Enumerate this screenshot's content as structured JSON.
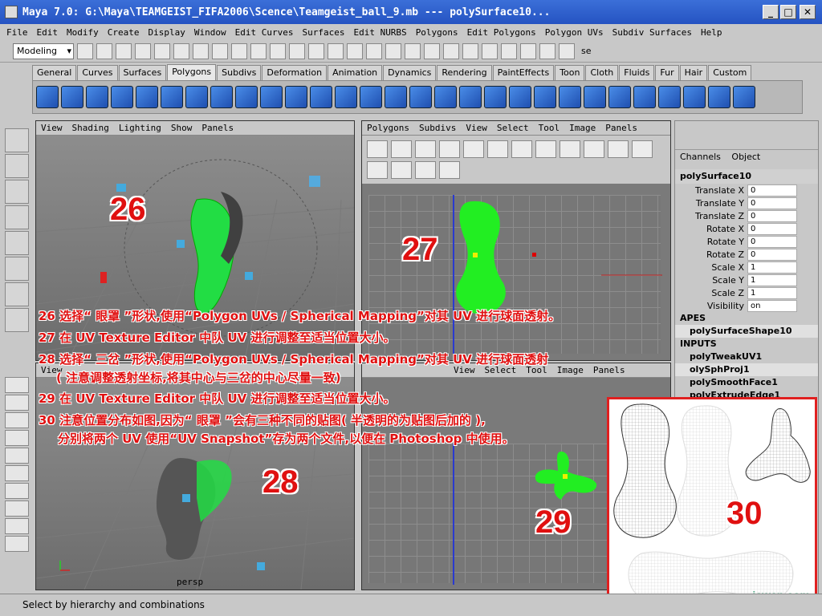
{
  "window": {
    "title": "Maya 7.0: G:\\Maya\\TEAMGEIST_FIFA2006\\Scence\\Teamgeist_ball_9.mb   ---   polySurface10...",
    "minimize": "_",
    "maximize": "□",
    "close": "✕"
  },
  "menubar": [
    "File",
    "Edit",
    "Modify",
    "Create",
    "Display",
    "Window",
    "Edit Curves",
    "Surfaces",
    "Edit NURBS",
    "Polygons",
    "Edit Polygons",
    "Polygon UVs",
    "Subdiv Surfaces",
    "Help"
  ],
  "status": {
    "mode": "Modeling",
    "field_label": "se"
  },
  "shelf": {
    "tabs": [
      "General",
      "Curves",
      "Surfaces",
      "Polygons",
      "Subdivs",
      "Deformation",
      "Animation",
      "Dynamics",
      "Rendering",
      "PaintEffects",
      "Toon",
      "Cloth",
      "Fluids",
      "Fur",
      "Hair",
      "Custom"
    ],
    "active": "Polygons"
  },
  "viewports": {
    "persp_top": {
      "menu": [
        "View",
        "Shading",
        "Lighting",
        "Show",
        "Panels"
      ]
    },
    "uv_top": {
      "menu": [
        "Polygons",
        "Subdivs",
        "View",
        "Select",
        "Tool",
        "Image",
        "Panels"
      ]
    },
    "persp_bottom": {
      "menu": [
        "View"
      ],
      "camera_label": "persp"
    },
    "uv_bottom": {
      "menu": [
        "View",
        "Select",
        "Tool",
        "Image",
        "Panels"
      ]
    }
  },
  "channel_box": {
    "menu": [
      "Channels",
      "Object"
    ],
    "object": "polySurface10",
    "attributes": [
      {
        "label": "Translate X",
        "value": "0"
      },
      {
        "label": "Translate Y",
        "value": "0"
      },
      {
        "label": "Translate Z",
        "value": "0"
      },
      {
        "label": "Rotate X",
        "value": "0"
      },
      {
        "label": "Rotate Y",
        "value": "0"
      },
      {
        "label": "Rotate Z",
        "value": "0"
      },
      {
        "label": "Scale X",
        "value": "1"
      },
      {
        "label": "Scale Y",
        "value": "1"
      },
      {
        "label": "Scale Z",
        "value": "1"
      },
      {
        "label": "Visibility",
        "value": "on"
      }
    ],
    "shapes_header": "APES",
    "shape": "polySurfaceShape10",
    "inputs_header": "INPUTS",
    "inputs": [
      "polyTweakUV1",
      "olySphProj1",
      "polySmoothFace1",
      "polyExtrudeEdge1"
    ]
  },
  "annotations": {
    "n26": "26",
    "n27": "27",
    "n28": "28",
    "n29": "29",
    "n30": "30",
    "line1": "26 选择“ 眼罩 ”形状,使用“Polygon UVs / Spherical Mapping”对其 UV 进行球面透射。",
    "line2": "27 在 UV Texture Editor 中队 UV 进行调整至适当位置大小。",
    "line3": "28 选择“ 三岔 ”形状,使用“Polygon UVs / Spherical Mapping”对其 UV 进行球面透射",
    "line4": "( 注意调整透射坐标,将其中心与三岔的中心尽量一致)",
    "line5": "29 在 UV Texture Editor 中队 UV 进行调整至适当位置大小。",
    "line6": "30 注意位置分布如图,因为“ 眼罩 ”会有三种不同的贴图( 半透明的为贴图后加的 ),",
    "line7": "分别将两个 UV 使用“UV Snapshot”存为两个文件,以便在 Photoshop 中使用。"
  },
  "help_line": "Select by hierarchy and combinations",
  "watermark": "jcwcn.com",
  "colors": {
    "uv_green": "#22dd22",
    "annotation_red": "#e01010",
    "title_blue": "#2553c2"
  }
}
